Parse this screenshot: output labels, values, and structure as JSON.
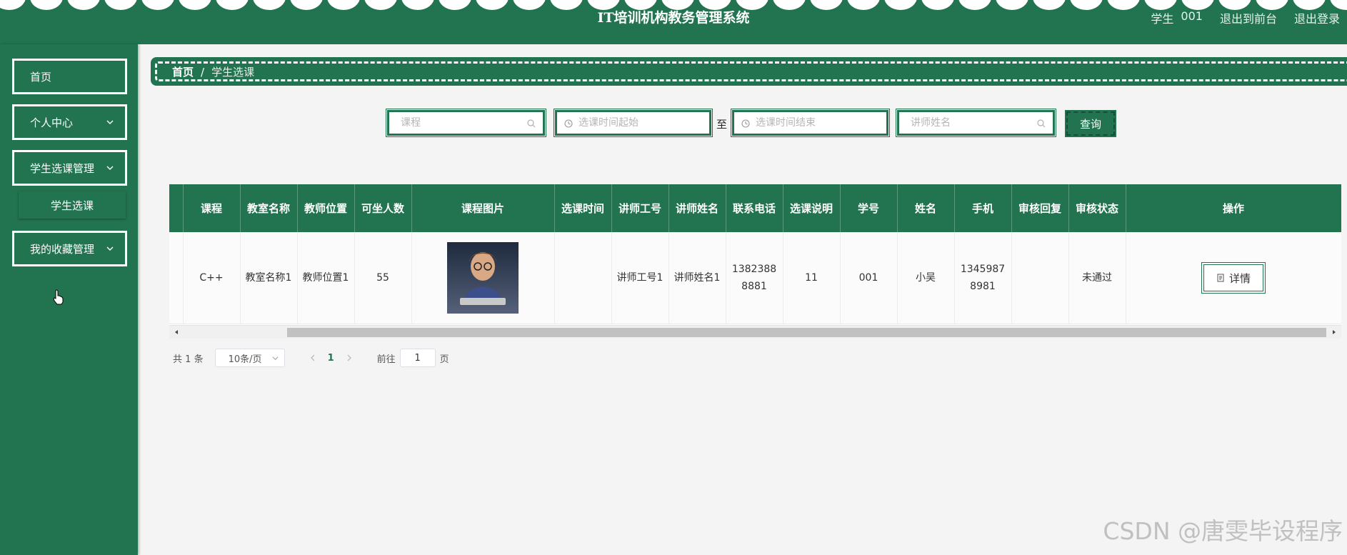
{
  "header": {
    "title": "IT培训机构教务管理系统",
    "user_role": "学生",
    "user_id": "001",
    "front_link": "退出到前台",
    "logout": "退出登录"
  },
  "sidebar": {
    "items": [
      {
        "label": "首页"
      },
      {
        "label": "个人中心"
      },
      {
        "label": "学生选课管理"
      },
      {
        "label": "学生选课"
      },
      {
        "label": "我的收藏管理"
      }
    ]
  },
  "breadcrumb": {
    "home": "首页",
    "separator": "/",
    "current": "学生选课"
  },
  "search": {
    "course_placeholder": "课程",
    "time_start_placeholder": "选课时间起始",
    "range_separator": "至",
    "time_end_placeholder": "选课时间结束",
    "teacher_placeholder": "讲师姓名",
    "query_label": "查询"
  },
  "table": {
    "headers": [
      "课程",
      "教室名称",
      "教师位置",
      "可坐人数",
      "课程图片",
      "选课时间",
      "讲师工号",
      "讲师姓名",
      "联系电话",
      "选课说明",
      "学号",
      "姓名",
      "手机",
      "审核回复",
      "审核状态",
      "操作"
    ],
    "rows": [
      {
        "course": "C++",
        "classroom": "教室名称1",
        "teacher_location": "教师位置1",
        "seats": "55",
        "select_time": "",
        "lecturer_id": "讲师工号1",
        "lecturer_name": "讲师姓名1",
        "phone": "13823888881",
        "remark": "11",
        "student_no": "001",
        "name": "小吴",
        "mobile": "13459878981",
        "review_reply": "",
        "review_status": "未通过",
        "action_label": "详情"
      }
    ]
  },
  "pagination": {
    "total_prefix": "共",
    "total": "1",
    "total_suffix": "条",
    "page_size": "10条/页",
    "current_page": "1",
    "goto_prefix": "前往",
    "goto_value": "1",
    "goto_suffix": "页"
  },
  "watermark": "CSDN @唐雯毕设程序",
  "colors": {
    "primary": "#227350",
    "background": "#f4f4f4"
  }
}
